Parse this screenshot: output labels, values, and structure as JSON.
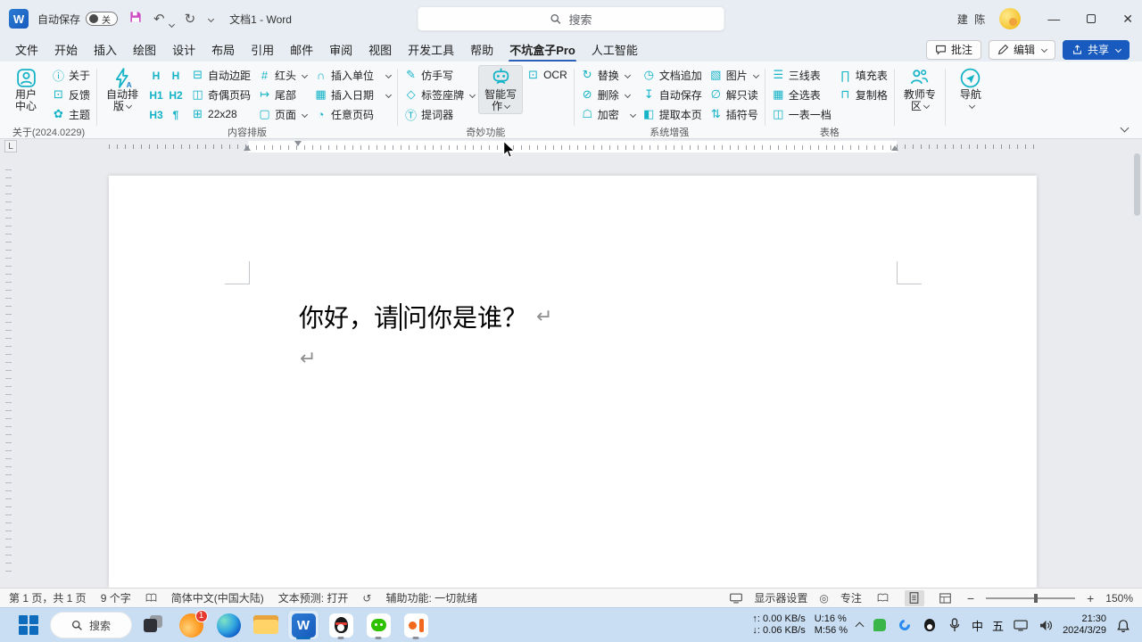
{
  "colors": {
    "accent_blue": "#185abd",
    "icon_cyan": "#14b3c7",
    "share_button": "#185abd",
    "taskbar_bg": "#c9def2"
  },
  "titlebar": {
    "autosave_label": "自动保存",
    "autosave_state": "关",
    "doc_title": "文档1 - Word",
    "search_placeholder": "搜索",
    "user_name": "建 陈"
  },
  "tab_actions": {
    "comments": "批注",
    "editing": "编辑",
    "share": "共享"
  },
  "tabs": {
    "items": [
      "文件",
      "开始",
      "插入",
      "绘图",
      "设计",
      "布局",
      "引用",
      "邮件",
      "审阅",
      "视图",
      "开发工具",
      "帮助",
      "不坑盒子Pro",
      "人工智能"
    ]
  },
  "ribbon": {
    "g1": {
      "label": "关于(2024.0229)",
      "big1": "用户",
      "big2": "中心",
      "items": [
        {
          "glyph": "ⓘ",
          "label": "关于"
        },
        {
          "glyph": "⊡",
          "label": "反馈"
        },
        {
          "glyph": "✿",
          "label": "主题"
        }
      ]
    },
    "g2": {
      "label": "内容排版",
      "big1": "自动排",
      "big2": "版",
      "hgrid": [
        "H",
        "H",
        "H1",
        "H2",
        "H3",
        "¶"
      ],
      "col1": [
        {
          "glyph": "⊟",
          "label": "自动边距"
        },
        {
          "glyph": "◫",
          "label": "奇偶页码"
        },
        {
          "glyph": "⊞",
          "label": "22x28"
        }
      ],
      "col2": [
        {
          "glyph": "#",
          "label": "红头"
        },
        {
          "glyph": "↦",
          "label": "尾部"
        },
        {
          "glyph": "▢",
          "label": "页面"
        }
      ],
      "col3": [
        {
          "glyph": "∩",
          "label": "插入单位"
        },
        {
          "glyph": "▦",
          "label": "插入日期"
        },
        {
          "glyph": "◔",
          "label": "任意页码"
        }
      ]
    },
    "g3": {
      "label": "奇妙功能",
      "col1": [
        {
          "glyph": "✎",
          "label": "仿手写"
        },
        {
          "glyph": "◇",
          "label": "标签座牌"
        },
        {
          "glyph": "Ⓣ",
          "label": "提词器"
        }
      ],
      "big1": "智能写",
      "big2": "作",
      "ocr": {
        "glyph": "⊡",
        "label": "OCR"
      }
    },
    "g4": {
      "label": "系统增强",
      "col1": [
        {
          "glyph": "↻",
          "label": "替换"
        },
        {
          "glyph": "⊘",
          "label": "删除"
        },
        {
          "glyph": "☖",
          "label": "加密"
        }
      ],
      "col2": [
        {
          "glyph": "◷",
          "label": "文档追加"
        },
        {
          "glyph": "↧",
          "label": "自动保存"
        },
        {
          "glyph": "◧",
          "label": "提取本页"
        }
      ],
      "col3": [
        {
          "glyph": "▧",
          "label": "图片"
        },
        {
          "glyph": "∅",
          "label": "解只读"
        },
        {
          "glyph": "⇅",
          "label": "插符号"
        }
      ]
    },
    "g5": {
      "label": "表格",
      "col1": [
        {
          "glyph": "☰",
          "label": "三线表"
        },
        {
          "glyph": "▦",
          "label": "全选表"
        },
        {
          "glyph": "◫",
          "label": "一表一档"
        }
      ],
      "col2": [
        {
          "glyph": "∏",
          "label": "填充表"
        },
        {
          "glyph": "⊓",
          "label": "复制格"
        }
      ]
    },
    "teacher1": "教师专",
    "teacher2": "区",
    "nav_label": "导航"
  },
  "document": {
    "before_caret": "你好，请",
    "after_caret": "问你是谁？",
    "return_mark": "↵"
  },
  "statusbar": {
    "page": "第 1 页，共 1 页",
    "words": "9 个字",
    "language": "简体中文(中国大陆)",
    "prediction": "文本预测: 打开",
    "accessibility": "辅助功能: 一切就绪",
    "display": "显示器设置",
    "focus": "专注",
    "zoom": "150%"
  },
  "taskbar": {
    "search_label": "搜索",
    "browser_badge": "1",
    "tray": {
      "up": "↑: 0.00 KB/s",
      "down": "↓: 0.06 KB/s",
      "cpu": "U:16 %",
      "mem": "M:56 %",
      "ime": "中",
      "wubi": "五",
      "time": "21:30",
      "date": "2024/3/29"
    }
  }
}
